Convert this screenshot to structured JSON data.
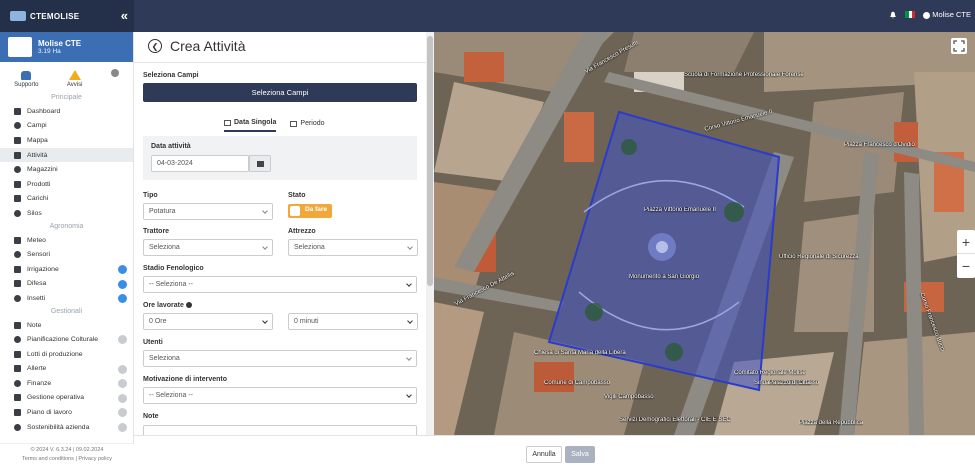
{
  "topbar": {
    "brand": "CTEMOLISE",
    "collapse_icon": "«",
    "user_name": "Molise CTE",
    "flag_colors": [
      "#009246",
      "#ffffff",
      "#ce2b37"
    ]
  },
  "sidebar": {
    "farm_name": "Molise CTE",
    "farm_area": "3.19 Ha",
    "quick": [
      {
        "label": "Supporto",
        "icon": "support-icon"
      },
      {
        "label": "Avvisi",
        "icon": "warning-icon"
      }
    ],
    "sections": [
      {
        "title": "Principale",
        "items": [
          {
            "label": "Dashboard",
            "icon": "dashboard-icon"
          },
          {
            "label": "Campi",
            "icon": "fields-icon"
          },
          {
            "label": "Mappa",
            "icon": "map-icon"
          },
          {
            "label": "Attività",
            "icon": "calendar-icon",
            "active": true
          },
          {
            "label": "Magazzini",
            "icon": "warehouse-icon"
          },
          {
            "label": "Prodotti",
            "icon": "product-icon"
          },
          {
            "label": "Carichi",
            "icon": "truck-icon"
          },
          {
            "label": "Silos",
            "icon": "silo-icon"
          }
        ]
      },
      {
        "title": "Agronomia",
        "items": [
          {
            "label": "Meteo",
            "icon": "weather-icon"
          },
          {
            "label": "Sensori",
            "icon": "sensor-icon"
          },
          {
            "label": "Irrigazione",
            "icon": "drop-icon",
            "badge": "pro"
          },
          {
            "label": "Difesa",
            "icon": "shield-icon",
            "badge": "pro"
          },
          {
            "label": "Insetti",
            "icon": "bug-icon",
            "badge": "pro"
          }
        ]
      },
      {
        "title": "Gestionali",
        "items": [
          {
            "label": "Note",
            "icon": "note-icon"
          },
          {
            "label": "Pianificazione Colturale",
            "icon": "plan-icon",
            "badge": "grey"
          },
          {
            "label": "Lotti di produzione",
            "icon": "lot-icon"
          },
          {
            "label": "Allerte",
            "icon": "bell-icon",
            "badge": "grey"
          },
          {
            "label": "Finanze",
            "icon": "finance-icon",
            "badge": "grey"
          },
          {
            "label": "Gestione operativa",
            "icon": "gear-icon",
            "badge": "grey"
          },
          {
            "label": "Piano di lavoro",
            "icon": "workplan-icon",
            "badge": "grey"
          },
          {
            "label": "Sostenibilità azienda",
            "icon": "leaf-icon",
            "badge": "grey"
          }
        ]
      }
    ],
    "footer_version": "© 2024  V. 6.3.24 | 09.02.2024",
    "footer_links": "Terms and conditions | Privacy policy"
  },
  "form": {
    "title": "Crea Attività",
    "select_fields_label": "Seleziona Campi",
    "select_fields_button": "Seleziona Campi",
    "tabs": [
      {
        "label": "Data Singola",
        "active": true
      },
      {
        "label": "Periodo",
        "active": false
      }
    ],
    "date_label": "Data attività",
    "date_value": "04-03-2024",
    "tipo_label": "Tipo",
    "tipo_value": "Potatura",
    "stato_label": "Stato",
    "stato_value": "Da fare",
    "trattore_label": "Trattore",
    "trattore_value": "Seleziona",
    "attrezzo_label": "Attrezzo",
    "attrezzo_value": "Seleziona",
    "stadio_label": "Stadio Fenologico",
    "stadio_value": "-- Seleziona --",
    "ore_label": "Ore lavorate",
    "ore_value": "0 Ore",
    "minuti_value": "0 minuti",
    "utenti_label": "Utenti",
    "utenti_value": "Seleziona",
    "motivazione_label": "Motivazione di intervento",
    "motivazione_value": "-- Seleziona --",
    "note_label": "Note"
  },
  "map": {
    "labels": [
      "Via Francesco Presutti",
      "Scuola di Formazione Professionale Forense",
      "Corso Vittorio Emanuele II",
      "Piazza Francesco d'Ovidio",
      "Piazza Vittorio Emanuele II",
      "Monumento a San Giorgio",
      "Via Francesco De Attellis",
      "Chiesa di Santa Maria della Libera",
      "Comune di Campobasso",
      "Vigili Campobasso",
      "Servizi Demografici Elettorali - CIE E SEC",
      "Ufficio Regionale di Sicurezza",
      "Corso Francesco Bucci",
      "Comitato Regionale Molise",
      "Sindaco di Campobasso",
      "Palazzo di Città",
      "Piazza della Repubblica"
    ],
    "zoom_in": "+",
    "zoom_out": "−"
  },
  "actions": {
    "cancel_label": "Annulla",
    "save_label": "Salva"
  }
}
